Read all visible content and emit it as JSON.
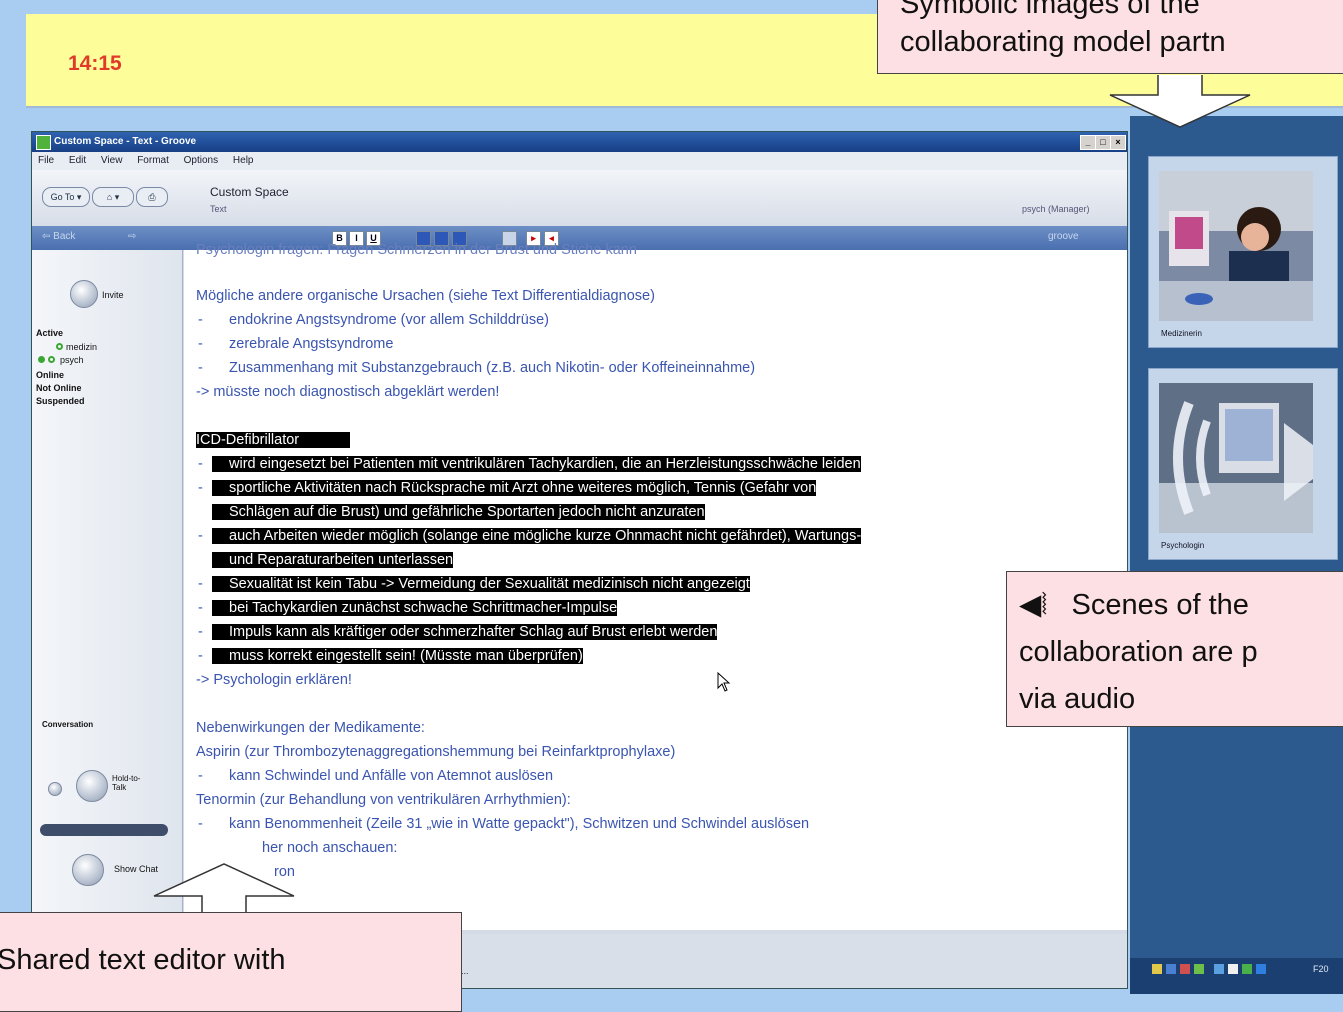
{
  "clock": "14:15",
  "callouts": {
    "top": "Symbolic images of the collaborating model partn",
    "top_line1": "Symbolic images of the",
    "top_line2": "collaborating model partn",
    "audio_icon": "speaker-icon",
    "audio_line1": "Scenes of the",
    "audio_line2": "collaboration are p",
    "audio_line3": "via audio",
    "bottom": "Shared text editor with"
  },
  "window": {
    "title": "Custom Space - Text - Groove",
    "controls": [
      "_",
      "□",
      "×"
    ],
    "menu": [
      "File",
      "Edit",
      "View",
      "Format",
      "Options",
      "Help"
    ],
    "nav_buttons": [
      "Go To ▾",
      "⌂ ▾",
      "⎙"
    ],
    "space_name": "Custom Space",
    "space_sub": "Text",
    "manager": "psych (Manager)",
    "toolbar2_left": [
      "⇦ Back",
      "⇨"
    ],
    "toolbar2_right": "groove",
    "format_buttons": [
      "B",
      "I",
      "U"
    ]
  },
  "sidebar": {
    "invite": "Invite",
    "active": "Active",
    "members": [
      "medizin",
      "psych"
    ],
    "online": "Online",
    "not_online": "Not Online",
    "suspended": "Suspended",
    "conversation": "Conversation",
    "hold_to_talk": "Hold-to-Talk",
    "show_chat": "Show Chat"
  },
  "editor": {
    "partial_top": "Psychologin fragen: Fragen Schmerzen in der Brust und Stiche kann",
    "heading1": "Mögliche andere organische Ursachen (siehe Text Differentialdiagnose)",
    "items1": [
      "endokrine Angstsyndrome (vor allem Schilddrüse)",
      "zerebrale Angstsyndrome",
      "Zusammenhang mit Substanzgebrauch (z.B. auch Nikotin- oder Koffeineinnahme)"
    ],
    "note1": "-> müsste noch diagnostisch abgeklärt werden!",
    "heading2": "ICD-Defibrillator",
    "items2": [
      "wird eingesetzt bei Patienten mit ventrikulären Tachykardien, die an Herzleistungsschwäche leiden",
      "sportliche Aktivitäten nach Rücksprache mit Arzt ohne weiteres möglich, Tennis (Gefahr von",
      "Schlägen auf die Brust) und gefährliche Sportarten jedoch nicht anzuraten",
      "auch Arbeiten wieder möglich (solange eine mögliche kurze Ohnmacht nicht gefährdet), Wartungs-",
      "und Reparaturarbeiten unterlassen",
      "Sexualität ist kein Tabu -> Vermeidung der Sexualität medizinisch nicht angezeigt",
      "bei Tachykardien zunächst schwache Schrittmacher-Impulse",
      "Impuls kann als kräftiger oder schmerzhafter Schlag auf Brust erlebt werden",
      "muss korrekt eingestellt sein! (Müsste man überprüfen)"
    ],
    "note2": "-> Psychologin erklären!",
    "heading3": "Nebenwirkungen der Medikamente:",
    "med1": "Aspirin (zur Thrombozytenaggregationshemmung bei Reinfarktprophylaxe)",
    "med1_item": "kann Schwindel und Anfälle von Atemnot auslösen",
    "med2": "Tenormin (zur Behandlung von ventrikulären Arrhythmien):",
    "med2_item": "kann Benommenheit (Zeile 31 „wie in Watte gepackt\"), Schwitzen und Schwindel auslösen",
    "partial1": "her noch anschauen:",
    "partial2": "ron",
    "bottom_tab": "Text ..."
  },
  "right_panel": {
    "card1_label": "Medizinerin",
    "card2_label": "Psychologin",
    "tray_time": "F20"
  }
}
